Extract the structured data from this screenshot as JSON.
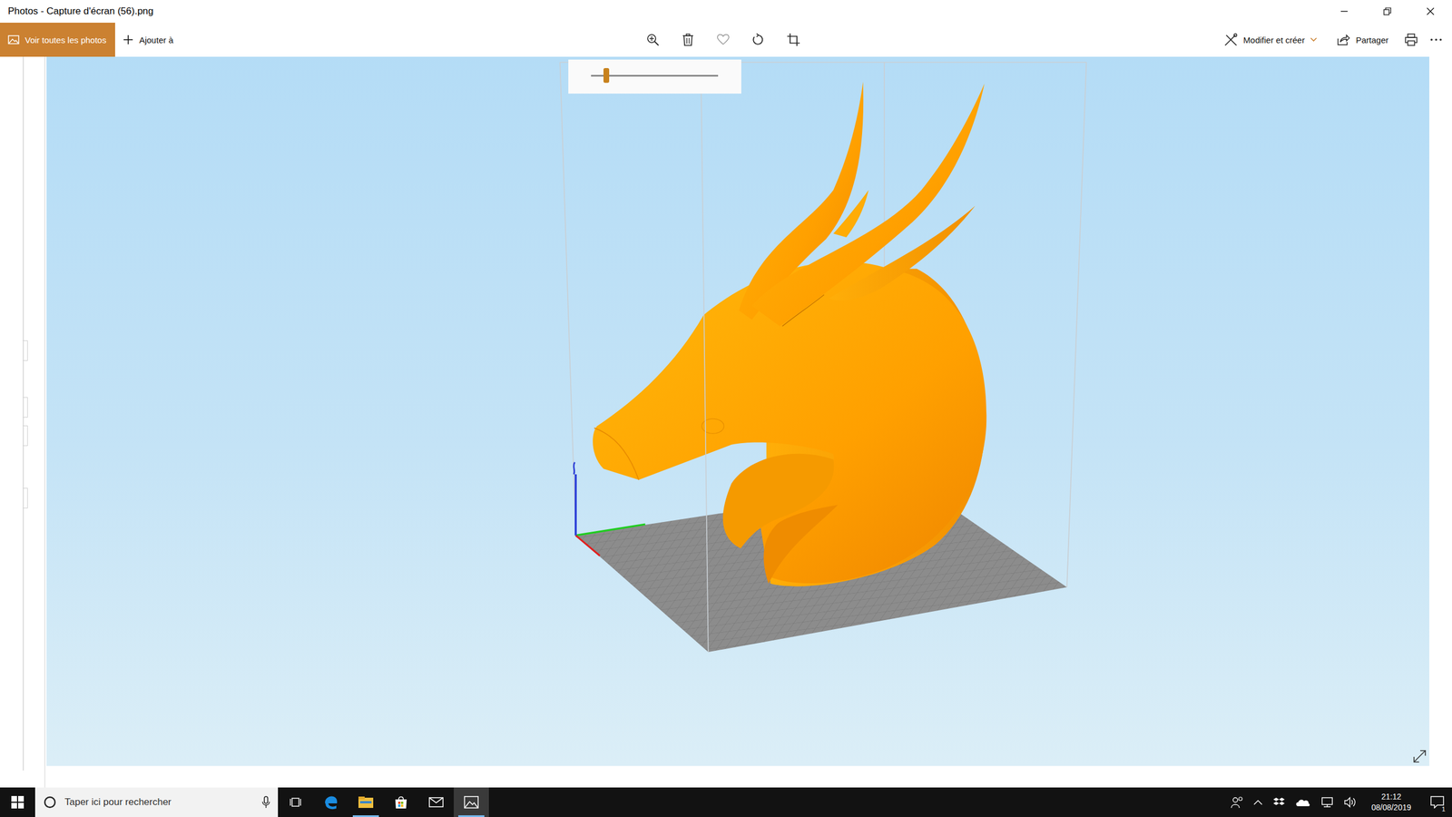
{
  "window": {
    "title": "Photos - Capture d'écran (56).png"
  },
  "toolbar": {
    "view_all": "Voir toutes les photos",
    "add": "Ajouter à",
    "edit": "Modifier et créer",
    "share": "Partager"
  },
  "viewer": {
    "layer_slider": {
      "level": 0.12
    }
  },
  "taskbar": {
    "search": {
      "placeholder": "Taper ici pour rechercher"
    },
    "time": "21:12",
    "date": "08/08/2019",
    "notification_count": "1"
  }
}
